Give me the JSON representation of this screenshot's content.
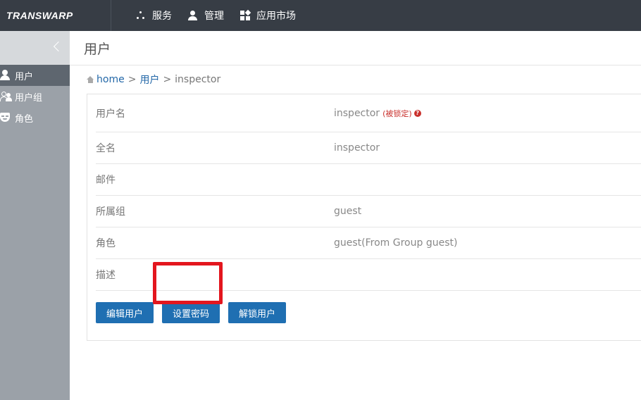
{
  "topbar": {
    "logo": "TRANSWARP",
    "nav": [
      {
        "label": "服务",
        "icon": "services-icon"
      },
      {
        "label": "管理",
        "icon": "person-icon"
      },
      {
        "label": "应用市场",
        "icon": "app-market-icon"
      }
    ]
  },
  "sidebar": {
    "items": [
      {
        "label": "用户",
        "icon": "user-icon",
        "active": true
      },
      {
        "label": "用户组",
        "icon": "user-group-icon",
        "active": false
      },
      {
        "label": "角色",
        "icon": "role-mask-icon",
        "active": false
      }
    ]
  },
  "page": {
    "title": "用户"
  },
  "breadcrumb": {
    "home": "home",
    "sep1": ">",
    "users": "用户",
    "sep2": ">",
    "current": "inspector"
  },
  "details": {
    "rows": [
      {
        "label": "用户名",
        "value": "inspector",
        "badge": "(被锁定)"
      },
      {
        "label": "全名",
        "value": "inspector"
      },
      {
        "label": "邮件",
        "value": ""
      },
      {
        "label": "所属组",
        "value": "guest"
      },
      {
        "label": "角色",
        "value": "guest(From Group guest)"
      },
      {
        "label": "描述",
        "value": ""
      }
    ],
    "help_glyph": "?"
  },
  "actions": {
    "edit": "编辑用户",
    "set_password": "设置密码",
    "unlock": "解锁用户"
  },
  "colors": {
    "topbar": "#373d45",
    "sidebar": "#9ba1a8",
    "sidebar_active": "#5e666f",
    "primary_button": "#1f6fb2",
    "locked_text": "#c9302c",
    "highlight_box": "#e3161e"
  }
}
